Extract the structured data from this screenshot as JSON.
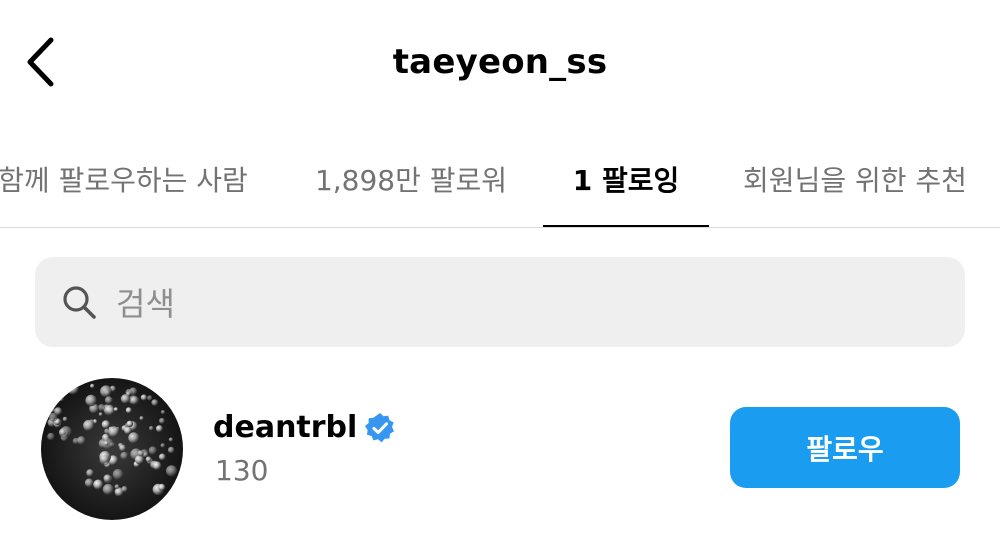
{
  "header": {
    "title": "taeyeon_ss",
    "back_icon": "chevron-left-icon"
  },
  "tabs": [
    {
      "label": "함께 팔로우하는 사람",
      "active": false
    },
    {
      "label": "1,898만 팔로워",
      "active": false
    },
    {
      "label": "1 팔로잉",
      "active": true
    },
    {
      "label": "회원님을 위한 추천",
      "active": false
    }
  ],
  "search": {
    "placeholder": "검색",
    "icon": "search-icon"
  },
  "users": [
    {
      "username": "deantrbl",
      "verified": true,
      "subtitle": "130",
      "button_label": "팔로우"
    }
  ],
  "colors": {
    "accent": "#1a9cf0",
    "verified": "#3797f0",
    "secondary_text": "#737373",
    "search_bg": "#efefef"
  }
}
